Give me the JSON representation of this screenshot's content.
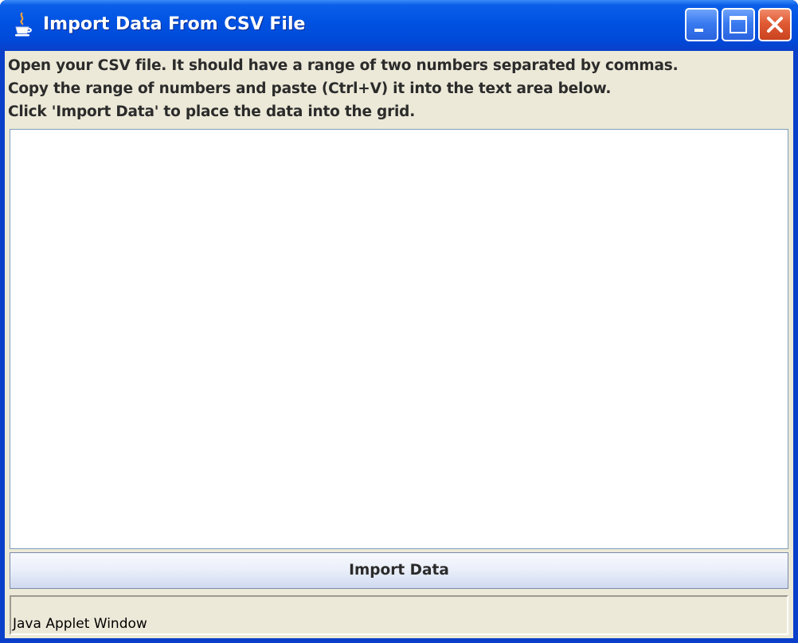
{
  "window": {
    "title": "Import Data From CSV File",
    "app_icon": "java-cup-icon",
    "controls": {
      "minimize_icon": "minimize-icon",
      "maximize_icon": "maximize-icon",
      "close_icon": "close-icon"
    },
    "colors": {
      "titlebar": "#0052e2",
      "close_button": "#e05a34",
      "client_background": "#ece9d8"
    }
  },
  "instructions": {
    "line1": "Open your CSV file.  It should have a range of two numbers separated by commas.",
    "line2": "Copy the range of numbers and paste (Ctrl+V) it into the text area below.",
    "line3": "Click 'Import Data' to place the data into the grid."
  },
  "data_area": {
    "value": ""
  },
  "import_button": {
    "label": "Import Data"
  },
  "status": {
    "text": "Java Applet Window"
  }
}
